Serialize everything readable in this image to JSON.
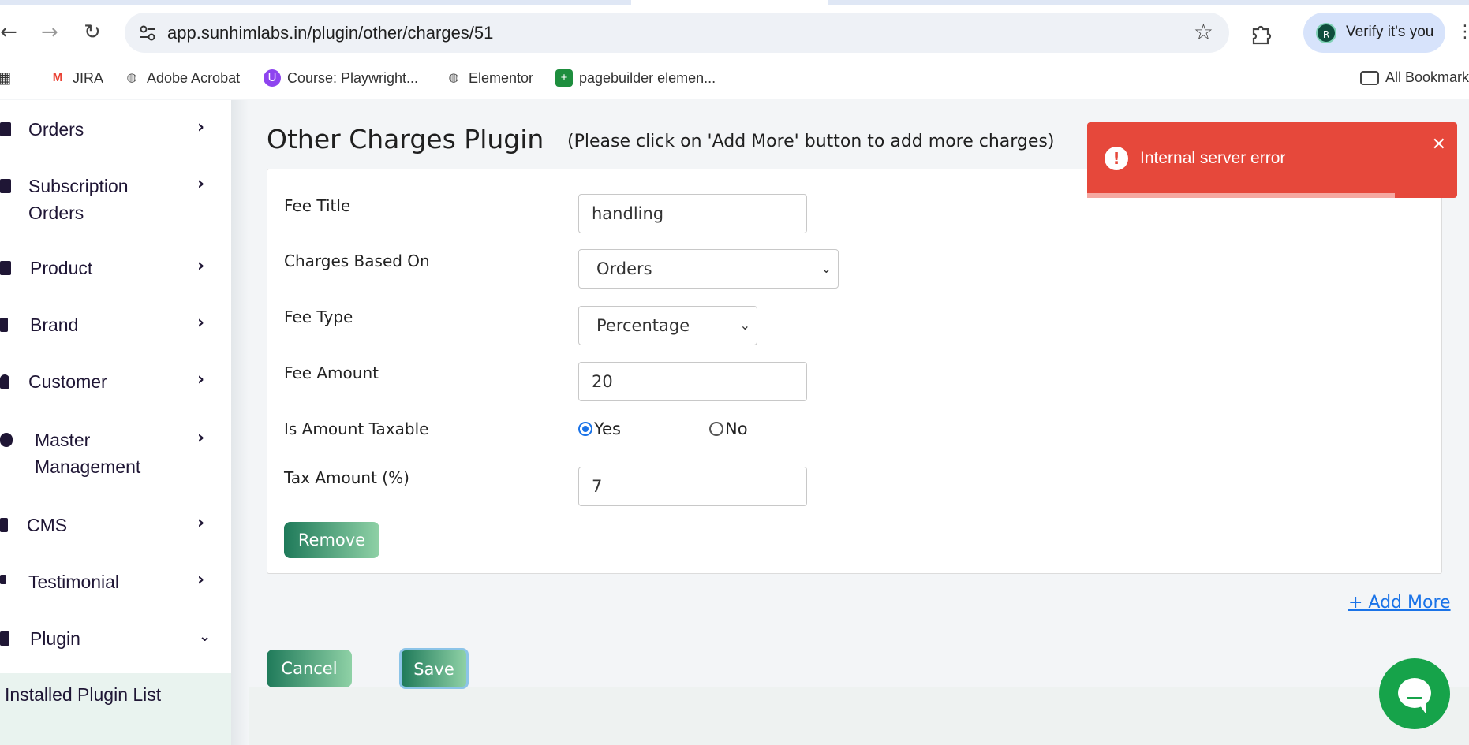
{
  "browser": {
    "url": "app.sunhimlabs.in/plugin/other/charges/51",
    "verify_label": "Verify it's you",
    "avatar_letter": "R",
    "bookmarks": [
      "JIRA",
      "Adobe Acrobat",
      "Course: Playwright...",
      "Elementor",
      "pagebuilder elemen..."
    ],
    "all_bookmarks": "All Bookmarks"
  },
  "sidebar": {
    "items": [
      {
        "label": "Orders"
      },
      {
        "label": "Subscription",
        "label2": "Orders"
      },
      {
        "label": "Product"
      },
      {
        "label": "Brand"
      },
      {
        "label": "Customer"
      },
      {
        "label": "Master",
        "label2": "Management"
      },
      {
        "label": "CMS"
      },
      {
        "label": "Testimonial"
      },
      {
        "label": "Plugin"
      }
    ],
    "sub_item": "Installed Plugin List"
  },
  "main": {
    "title": "Other Charges Plugin",
    "note": "(Please click on 'Add More' button to add more charges)",
    "fields": {
      "fee_title_label": "Fee Title",
      "fee_title_value": "handling",
      "charges_based_label": "Charges Based On",
      "charges_based_value": "Orders",
      "fee_type_label": "Fee Type",
      "fee_type_value": "Percentage",
      "fee_amount_label": "Fee Amount",
      "fee_amount_value": "20",
      "taxable_label": "Is Amount Taxable",
      "taxable_yes": "Yes",
      "taxable_no": "No",
      "tax_amount_label": "Tax Amount (%)",
      "tax_amount_value": "7"
    },
    "remove_label": "Remove",
    "add_more_label": "+ Add More",
    "cancel_label": "Cancel",
    "save_label": "Save"
  },
  "toast": {
    "message": "Internal server error"
  },
  "colors": {
    "accent_green": "#1f7a5a",
    "toast_red": "#e6483b",
    "link_blue": "#1a73e8"
  }
}
